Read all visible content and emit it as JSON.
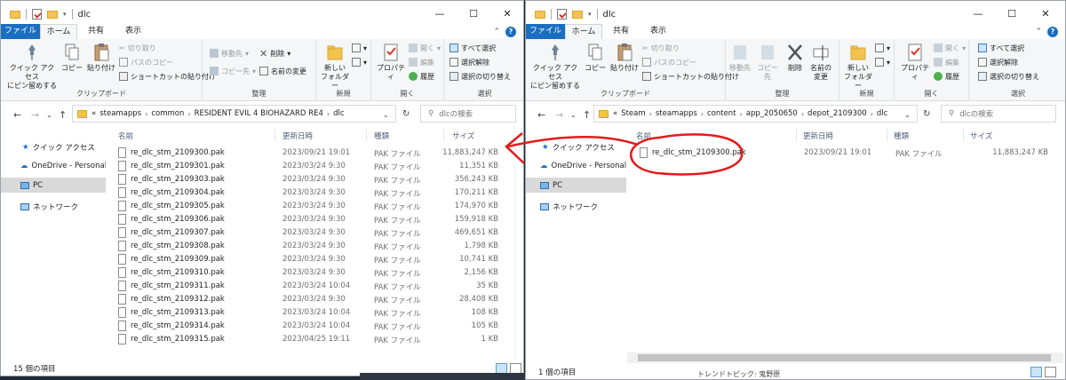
{
  "window_left": {
    "title": "dlc",
    "controls": {
      "minimize": "—",
      "maximize": "☐",
      "close": "✕"
    },
    "tabs": {
      "file": "ファイル",
      "home": "ホーム",
      "share": "共有",
      "view": "表示"
    },
    "ribbon": {
      "pin_quick_access": "クイック アクセス\nにピン留めする",
      "copy": "コピー",
      "paste": "貼り付け",
      "cut": "切り取り",
      "copy_path": "パスのコピー",
      "paste_shortcut": "ショートカットの貼り付け",
      "clipboard_label": "クリップボード",
      "move_to": "移動先",
      "copy_to": "コピー先",
      "delete": "削除",
      "rename": "名前の変更",
      "organize_label": "整理",
      "new_folder": "新しい\nフォルダー",
      "new_label": "新規",
      "properties": "プロパティ",
      "open": "開く",
      "edit": "編集",
      "history": "履歴",
      "open_label": "開く",
      "select_all": "すべて選択",
      "select_none": "選択解除",
      "invert_selection": "選択の切り替え",
      "select_label": "選択"
    },
    "address": {
      "prefix": "«",
      "crumbs": [
        "steamapps",
        "common",
        "RESIDENT EVIL 4  BIOHAZARD RE4",
        "dlc"
      ],
      "search_placeholder": "dlcの検索"
    },
    "nav": {
      "quick_access": "クイック アクセス",
      "onedrive": "OneDrive - Personal",
      "pc": "PC",
      "network": "ネットワーク"
    },
    "columns": {
      "name": "名前",
      "date": "更新日時",
      "type": "種類",
      "size": "サイズ"
    },
    "files": [
      {
        "name": "re_dlc_stm_2109300.pak",
        "date": "2023/09/21 19:01",
        "type": "PAK ファイル",
        "size": "11,883,247 KB"
      },
      {
        "name": "re_dlc_stm_2109301.pak",
        "date": "2023/03/24 9:30",
        "type": "PAK ファイル",
        "size": "11,351 KB"
      },
      {
        "name": "re_dlc_stm_2109303.pak",
        "date": "2023/03/24 9:30",
        "type": "PAK ファイル",
        "size": "356,243 KB"
      },
      {
        "name": "re_dlc_stm_2109304.pak",
        "date": "2023/03/24 9:30",
        "type": "PAK ファイル",
        "size": "170,211 KB"
      },
      {
        "name": "re_dlc_stm_2109305.pak",
        "date": "2023/03/24 9:30",
        "type": "PAK ファイル",
        "size": "174,970 KB"
      },
      {
        "name": "re_dlc_stm_2109306.pak",
        "date": "2023/03/24 9:30",
        "type": "PAK ファイル",
        "size": "159,918 KB"
      },
      {
        "name": "re_dlc_stm_2109307.pak",
        "date": "2023/03/24 9:30",
        "type": "PAK ファイル",
        "size": "469,651 KB"
      },
      {
        "name": "re_dlc_stm_2109308.pak",
        "date": "2023/03/24 9:30",
        "type": "PAK ファイル",
        "size": "1,798 KB"
      },
      {
        "name": "re_dlc_stm_2109309.pak",
        "date": "2023/03/24 9:30",
        "type": "PAK ファイル",
        "size": "10,741 KB"
      },
      {
        "name": "re_dlc_stm_2109310.pak",
        "date": "2023/03/24 9:30",
        "type": "PAK ファイル",
        "size": "2,156 KB"
      },
      {
        "name": "re_dlc_stm_2109311.pak",
        "date": "2023/03/24 10:04",
        "type": "PAK ファイル",
        "size": "35 KB"
      },
      {
        "name": "re_dlc_stm_2109312.pak",
        "date": "2023/03/24 9:30",
        "type": "PAK ファイル",
        "size": "28,408 KB"
      },
      {
        "name": "re_dlc_stm_2109313.pak",
        "date": "2023/03/24 10:04",
        "type": "PAK ファイル",
        "size": "108 KB"
      },
      {
        "name": "re_dlc_stm_2109314.pak",
        "date": "2023/03/24 10:04",
        "type": "PAK ファイル",
        "size": "105 KB"
      },
      {
        "name": "re_dlc_stm_2109315.pak",
        "date": "2023/04/25 19:11",
        "type": "PAK ファイル",
        "size": "1 KB"
      }
    ],
    "status": "15 個の項目"
  },
  "window_right": {
    "title": "dlc",
    "controls": {
      "minimize": "—",
      "maximize": "☐",
      "close": "✕"
    },
    "tabs": {
      "file": "ファイル",
      "home": "ホーム",
      "share": "共有",
      "view": "表示"
    },
    "ribbon": {
      "pin_quick_access": "クイック アクセス\nにピン留めする",
      "copy": "コピー",
      "paste": "貼り付け",
      "cut": "切り取り",
      "copy_path": "パスのコピー",
      "paste_shortcut": "ショートカットの貼り付け",
      "clipboard_label": "クリップボード",
      "move_to": "移動先",
      "copy_to": "コピー先",
      "delete": "削除",
      "rename": "名前の\n変更",
      "organize_label": "整理",
      "new_folder": "新しい\nフォルダー",
      "new_label": "新規",
      "properties": "プロパティ",
      "open": "開く",
      "edit": "編集",
      "history": "履歴",
      "open_label": "開く",
      "select_all": "すべて選択",
      "select_none": "選択解除",
      "invert_selection": "選択の切り替え",
      "select_label": "選択"
    },
    "address": {
      "prefix": "«",
      "crumbs": [
        "Steam",
        "steamapps",
        "content",
        "app_2050650",
        "depot_2109300",
        "dlc"
      ],
      "search_placeholder": "dlcの検索"
    },
    "nav": {
      "quick_access": "クイック アクセス",
      "onedrive": "OneDrive - Personal",
      "pc": "PC",
      "network": "ネットワーク"
    },
    "columns": {
      "name": "名前",
      "date": "更新日時",
      "type": "種類",
      "size": "サイズ"
    },
    "files": [
      {
        "name": "re_dlc_stm_2109300.pak",
        "date": "2023/09/21 19:01",
        "type": "PAK ファイル",
        "size": "11,883,247 KB"
      }
    ],
    "status": "1 個の項目"
  },
  "background_text": "トレンドトピック: 鬼野原",
  "colors": {
    "accent": "#1a6ec1",
    "annotation": "#e21b1b",
    "folder": "#f3c34f"
  },
  "icons": [
    "folder-icon",
    "properties-icon",
    "chevron-down-icon",
    "minimize-icon",
    "maximize-icon",
    "close-icon",
    "help-icon",
    "pin-icon",
    "copy-icon",
    "paste-icon",
    "cut-icon",
    "delete-icon",
    "rename-icon",
    "new-folder-icon",
    "back-icon",
    "forward-icon",
    "up-icon",
    "refresh-icon",
    "search-icon",
    "star-icon",
    "cloud-icon",
    "pc-icon",
    "network-icon",
    "file-icon",
    "details-view-icon",
    "large-icons-view-icon"
  ]
}
